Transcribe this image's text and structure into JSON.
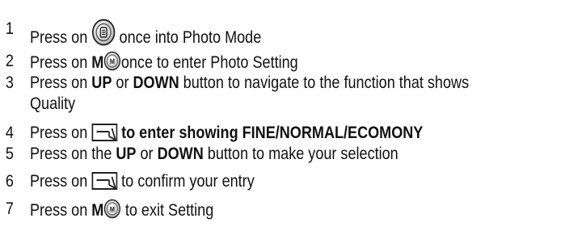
{
  "steps": [
    {
      "number": "1",
      "text_before_icon": "Press on ",
      "icon": "menu-round-button-icon",
      "text_after_icon": " once into Photo Mode"
    },
    {
      "number": "2",
      "text_before": "Press on ",
      "bold_key": "M",
      "icon": "m-round-button-icon",
      "icon_letter": "M",
      "text_after": "once to enter Photo Setting"
    },
    {
      "number": "3",
      "text_a": "Press on ",
      "bold_up": "UP",
      "text_or": " or ",
      "bold_down": "DOWN",
      "text_b": " button to navigate to the function that shows",
      "text_continued": "Quality"
    },
    {
      "number": "4",
      "text_before_icon": "Press on ",
      "icon": "enter-button-icon",
      "bold_after_icon": " to enter showing FINE/NORMAL/ECOMONY"
    },
    {
      "number": "5",
      "text_a": "Press on the ",
      "bold_up": "UP",
      "text_or": " or ",
      "bold_down": "DOWN",
      "text_b": " button to make your selection"
    },
    {
      "number": "6",
      "text_before_icon": "Press on ",
      "icon": "enter-button-icon",
      "text_after_icon": " to confirm your entry"
    },
    {
      "number": "7",
      "text_before": "Press on ",
      "bold_key": "M",
      "icon": "m-round-button-icon",
      "icon_letter": "M",
      "text_after": " to exit Setting"
    }
  ]
}
